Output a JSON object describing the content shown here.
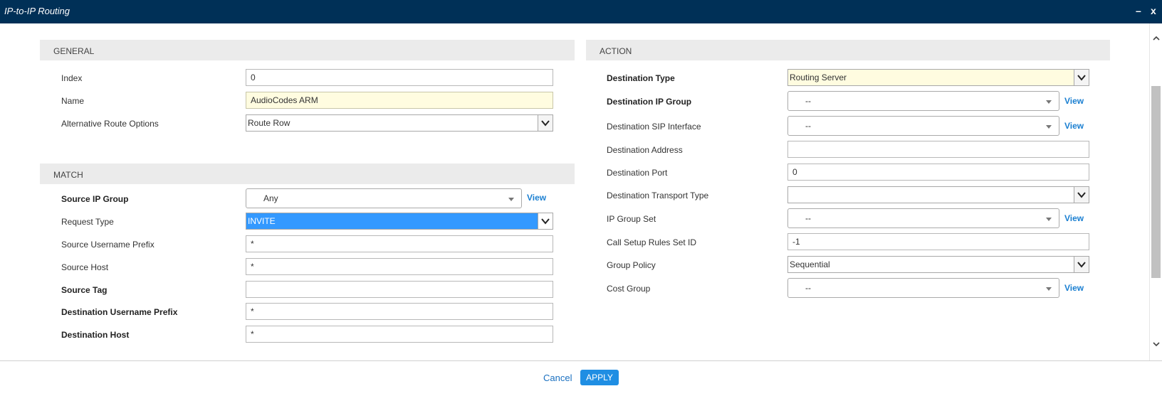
{
  "window": {
    "title": "IP-to-IP Routing",
    "minimize_label": "–",
    "close_label": "x"
  },
  "general": {
    "header": "GENERAL",
    "index": {
      "label": "Index",
      "value": "0"
    },
    "name": {
      "label": "Name",
      "value": "AudioCodes ARM"
    },
    "alt_route": {
      "label": "Alternative Route Options",
      "value": "Route Row"
    }
  },
  "match": {
    "header": "MATCH",
    "source_ip_group": {
      "label": "Source IP Group",
      "value": "Any",
      "view": "View"
    },
    "request_type": {
      "label": "Request Type",
      "value": "INVITE"
    },
    "source_username_prefix": {
      "label": "Source Username Prefix",
      "value": "*"
    },
    "source_host": {
      "label": "Source Host",
      "value": "*"
    },
    "source_tag": {
      "label": "Source Tag",
      "value": ""
    },
    "dest_username_prefix": {
      "label": "Destination Username Prefix",
      "value": "*"
    },
    "dest_host": {
      "label": "Destination Host",
      "value": "*"
    }
  },
  "action": {
    "header": "ACTION",
    "dest_type": {
      "label": "Destination Type",
      "value": "Routing Server"
    },
    "dest_ip_group": {
      "label": "Destination IP Group",
      "value": "--",
      "view": "View"
    },
    "dest_sip_interface": {
      "label": "Destination SIP Interface",
      "value": "--",
      "view": "View"
    },
    "dest_address": {
      "label": "Destination Address",
      "value": ""
    },
    "dest_port": {
      "label": "Destination Port",
      "value": "0"
    },
    "dest_transport": {
      "label": "Destination Transport Type",
      "value": ""
    },
    "ip_group_set": {
      "label": "IP Group Set",
      "value": "--",
      "view": "View"
    },
    "call_setup_rules": {
      "label": "Call Setup Rules Set ID",
      "value": "-1"
    },
    "group_policy": {
      "label": "Group Policy",
      "value": "Sequential"
    },
    "cost_group": {
      "label": "Cost Group",
      "value": "--",
      "view": "View"
    }
  },
  "footer": {
    "cancel_label": "Cancel",
    "apply_label": "APPLY"
  }
}
